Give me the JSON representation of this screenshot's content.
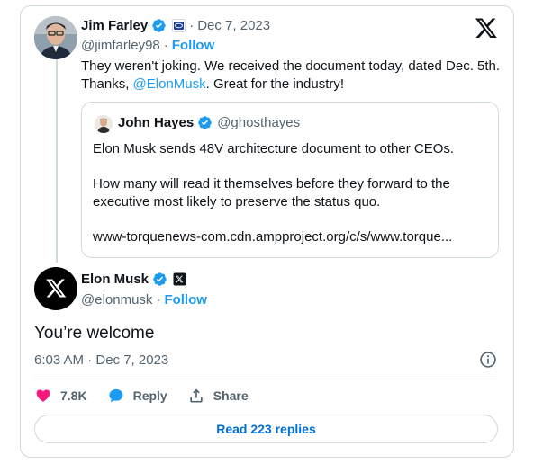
{
  "main_tweet": {
    "author_name": "Jim Farley",
    "separator": "·",
    "date": "Dec 7, 2023",
    "handle": "@jimfarley98",
    "follow_label": "Follow",
    "text_part1": "They weren't joking. We received the document today, dated Dec. 5th. Thanks, ",
    "mention": "@ElonMusk",
    "text_part2": ". Great for the industry!"
  },
  "quote_tweet": {
    "author_name": "John Hayes",
    "handle": "@ghosthayes",
    "line1": "Elon Musk sends 48V architecture document to other CEOs.",
    "line2": "How many will read it themselves before they forward to the executive most likely to preserve the status quo.",
    "link": "www-torquenews-com.cdn.ampproject.org/c/s/www.torque..."
  },
  "reply_tweet": {
    "author_name": "Elon Musk",
    "handle": "@elonmusk",
    "follow_label": "Follow",
    "text": "You’re welcome",
    "timestamp": "6:03 AM · Dec 7, 2023"
  },
  "actions": {
    "likes": "7.8K",
    "reply_label": "Reply",
    "share_label": "Share"
  },
  "read_replies_label": "Read 223 replies",
  "colors": {
    "accent": "#1d9bf0",
    "like": "#f91880",
    "text": "#0f1419",
    "muted": "#536471",
    "border": "#cfd9de"
  }
}
